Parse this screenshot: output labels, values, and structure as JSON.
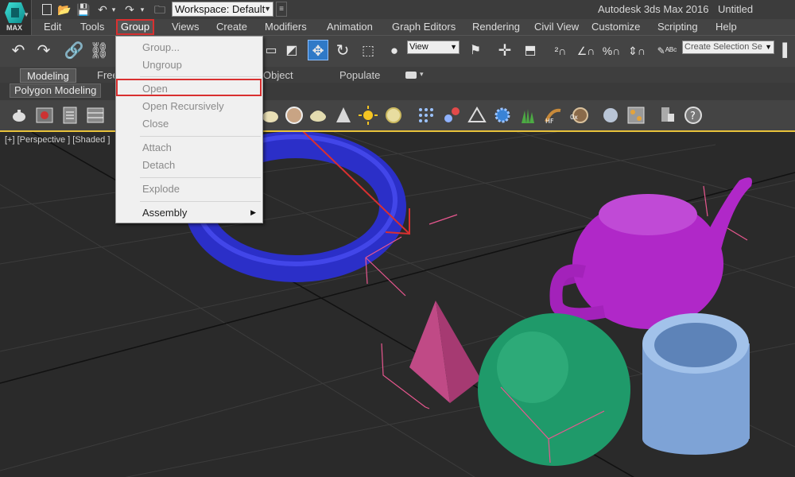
{
  "app": {
    "name": "Autodesk 3ds Max 2016",
    "document": "Untitled",
    "logo_text": "MAX"
  },
  "quick_access": {
    "workspace_label": "Workspace: Default",
    "icons": [
      "new-file-icon",
      "open-folder-icon",
      "save-icon",
      "undo-icon",
      "redo-icon",
      "project-folder-icon"
    ]
  },
  "menu": {
    "items": [
      "Edit",
      "Tools",
      "Group",
      "Views",
      "Create",
      "Modifiers",
      "Animation",
      "Graph Editors",
      "Rendering",
      "Civil View",
      "Customize",
      "Scripting",
      "Help"
    ],
    "active": "Group"
  },
  "toolbar": {
    "view_dropdown": "View",
    "selection_set_placeholder": "Create Selection Se"
  },
  "ribbon": {
    "tabs": [
      "Modeling",
      "Freeform",
      "Object Paint",
      "Populate"
    ],
    "active_tab": "Modeling",
    "panel_label": "Polygon Modeling"
  },
  "viewport": {
    "label": "[+] [Perspective ] [Shaded ]"
  },
  "group_menu": {
    "items": [
      {
        "label": "Group...",
        "enabled": false
      },
      {
        "label": "Ungroup",
        "enabled": false
      },
      {
        "label": "Open",
        "enabled": false,
        "highlighted": true
      },
      {
        "label": "Open Recursively",
        "enabled": false
      },
      {
        "label": "Close",
        "enabled": false
      },
      {
        "label": "Attach",
        "enabled": false
      },
      {
        "label": "Detach",
        "enabled": false
      },
      {
        "label": "Explode",
        "enabled": false
      },
      {
        "label": "Assembly",
        "enabled": true,
        "submenu": true
      }
    ]
  },
  "colors": {
    "highlight_red": "#d93030",
    "torus": "#2a2fd0",
    "teapot": "#b028c8",
    "pyramid": "#c04a86",
    "sphere": "#1f9a6a",
    "tube": "#7ea3d6",
    "selection_blue": "#2f79c7"
  }
}
